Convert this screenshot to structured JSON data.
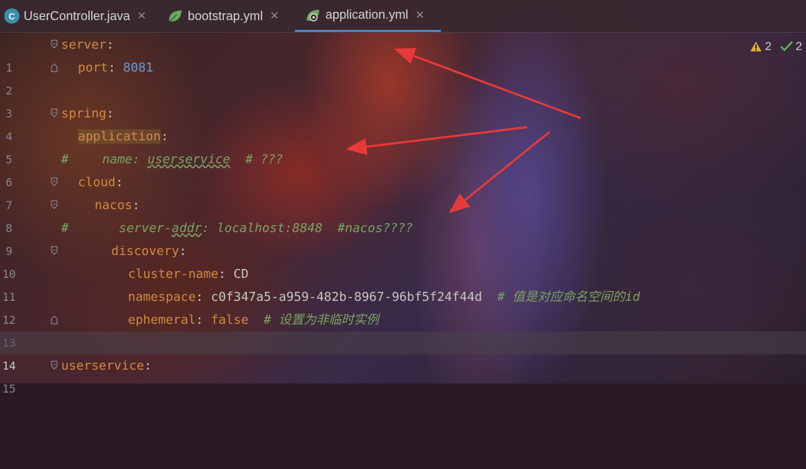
{
  "tabs": [
    {
      "label": "UserController.java",
      "icon": "java-class-icon",
      "active": false
    },
    {
      "label": "bootstrap.yml",
      "icon": "spring-leaf-icon",
      "active": false
    },
    {
      "label": "application.yml",
      "icon": "spring-boot-config-icon",
      "active": true
    }
  ],
  "status": {
    "warnings": "2",
    "checks": "2"
  },
  "lines": [
    {
      "num": "1",
      "key": "server",
      "sep": ":"
    },
    {
      "num": "2",
      "key": "port",
      "sep": ": ",
      "value": "8081"
    },
    {
      "num": "3"
    },
    {
      "num": "4",
      "key": "spring",
      "sep": ":"
    },
    {
      "num": "5",
      "key": "application",
      "sep": ":"
    },
    {
      "num": "6",
      "hash": "#",
      "comment_a": "name: ",
      "comment_b": "userservice",
      "comment_c": "  # ???"
    },
    {
      "num": "7",
      "key": "cloud",
      "sep": ":"
    },
    {
      "num": "8",
      "key": "nacos",
      "sep": ":"
    },
    {
      "num": "9",
      "hash": "#",
      "comment_a": "server-",
      "comment_b": "addr",
      "comment_c": ": localhost:8848  #nacos????"
    },
    {
      "num": "10",
      "key": "discovery",
      "sep": ":"
    },
    {
      "num": "11",
      "key": "cluster-name",
      "sep": ": ",
      "value": "CD"
    },
    {
      "num": "12",
      "key": "namespace",
      "sep": ": ",
      "value": "c0f347a5-a959-482b-8967-96bf5f24f44d",
      "comment": "  # 值是对应命名空间的id"
    },
    {
      "num": "13",
      "key": "ephemeral",
      "sep": ": ",
      "value": "false",
      "comment": "  # 设置为非临时实例"
    },
    {
      "num": "14"
    },
    {
      "num": "15",
      "key": "userservice",
      "sep": ":"
    }
  ],
  "colors": {
    "key": "#d08a3e",
    "number": "#6c9bd6",
    "comment": "#7aa360",
    "annotation_arrow": "#e8393a"
  }
}
